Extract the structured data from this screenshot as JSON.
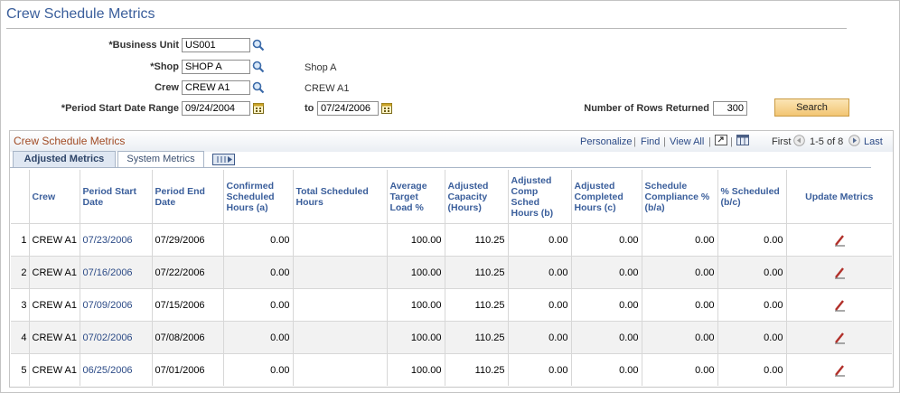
{
  "page": {
    "title": "Crew Schedule Metrics"
  },
  "criteria": {
    "business_unit": {
      "label": "*Business Unit",
      "value": "US001"
    },
    "shop": {
      "label": "*Shop",
      "value": "SHOP A",
      "description": "Shop A"
    },
    "crew": {
      "label": "Crew",
      "value": "CREW A1",
      "description": "CREW A1"
    },
    "period": {
      "label": "*Period Start Date Range",
      "from": "09/24/2004",
      "to_label": "to",
      "to": "07/24/2006"
    },
    "rows_returned": {
      "label": "Number of Rows Returned",
      "value": "300"
    },
    "search_label": "Search"
  },
  "grid": {
    "title": "Crew Schedule Metrics",
    "nav": {
      "personalize": "Personalize",
      "find": "Find",
      "view_all": "View All",
      "first": "First",
      "range": "1-5 of 8",
      "last": "Last"
    },
    "tabs": [
      {
        "label": "Adjusted Metrics"
      },
      {
        "label": "System Metrics"
      }
    ],
    "columns": [
      "Crew",
      "Period Start Date",
      "Period End Date",
      "Confirmed Scheduled Hours (a)",
      "Total Scheduled Hours",
      "Average Target Load %",
      "Adjusted Capacity (Hours)",
      "Adjusted Comp Sched Hours (b)",
      "Adjusted Completed Hours (c)",
      "Schedule Compliance % (b/a)",
      "% Scheduled (b/c)",
      "Update Metrics"
    ],
    "rows": [
      {
        "num": "1",
        "crew": "CREW A1",
        "start": "07/23/2006",
        "end": "07/29/2006",
        "confirmed": "0.00",
        "total": "",
        "avg_load": "100.00",
        "capacity": "110.25",
        "comp_sched": "0.00",
        "completed": "0.00",
        "compliance": "0.00",
        "scheduled": "0.00"
      },
      {
        "num": "2",
        "crew": "CREW A1",
        "start": "07/16/2006",
        "end": "07/22/2006",
        "confirmed": "0.00",
        "total": "",
        "avg_load": "100.00",
        "capacity": "110.25",
        "comp_sched": "0.00",
        "completed": "0.00",
        "compliance": "0.00",
        "scheduled": "0.00"
      },
      {
        "num": "3",
        "crew": "CREW A1",
        "start": "07/09/2006",
        "end": "07/15/2006",
        "confirmed": "0.00",
        "total": "",
        "avg_load": "100.00",
        "capacity": "110.25",
        "comp_sched": "0.00",
        "completed": "0.00",
        "compliance": "0.00",
        "scheduled": "0.00"
      },
      {
        "num": "4",
        "crew": "CREW A1",
        "start": "07/02/2006",
        "end": "07/08/2006",
        "confirmed": "0.00",
        "total": "",
        "avg_load": "100.00",
        "capacity": "110.25",
        "comp_sched": "0.00",
        "completed": "0.00",
        "compliance": "0.00",
        "scheduled": "0.00"
      },
      {
        "num": "5",
        "crew": "CREW A1",
        "start": "06/25/2006",
        "end": "07/01/2006",
        "confirmed": "0.00",
        "total": "",
        "avg_load": "100.00",
        "capacity": "110.25",
        "comp_sched": "0.00",
        "completed": "0.00",
        "compliance": "0.00",
        "scheduled": "0.00"
      }
    ]
  },
  "colors": {
    "title": "#3a5e9b",
    "link": "#2b4a86",
    "grid_title": "#a14b24",
    "search_button": "#f2c573"
  }
}
